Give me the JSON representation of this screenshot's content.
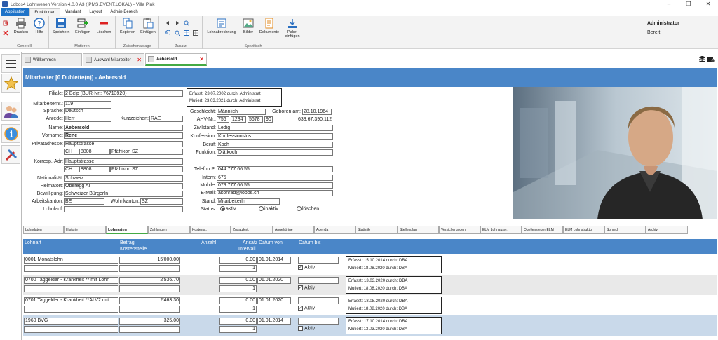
{
  "window": {
    "title": "Lobos4 Lohnwesen Version 4.0.0 A3 (IPMS.EVENT.LOKAL) - Villa Pink",
    "buttons": [
      "–",
      "❐",
      "✕"
    ]
  },
  "menu": {
    "tabs": [
      "Applikation",
      "Funktionen",
      "Mandant",
      "Layout",
      "Admin-Bereich"
    ]
  },
  "ribbon": {
    "groups": {
      "generell": "Generell",
      "mutieren": "Mutieren",
      "zwischenablage": "Zwischenablage",
      "zusatz": "Zusatz",
      "spezifisch": "Spezifisch"
    },
    "buttons": {
      "drucken": "Drucken",
      "hilfe": "Hilfe",
      "speichern": "Speichern",
      "einfuegen": "Einfügen",
      "loeschen": "Löschen",
      "kopieren": "Kopieren",
      "einfuegen2": "Einfügen",
      "lohnabrechnung": "Lohnabrechnung",
      "bilder": "Bilder",
      "dokumente": "Dokumente",
      "paket1": "Paket",
      "paket2": "einfügen"
    }
  },
  "user": {
    "name": "Administrator",
    "status": "Bereit"
  },
  "doc_tabs": {
    "willkommen": "Willkommen",
    "auswahl": "Auswahl Mitarbeiter",
    "aebersold": "Aebersold"
  },
  "header": {
    "title": "Mitarbeiter [0 Dublette(n)] - Aebersold"
  },
  "form": {
    "labels": {
      "filiale": "Filiale:",
      "mitarbeiternr": "Mitarbeiternr.:",
      "sprache": "Sprache:",
      "anrede": "Anrede:",
      "kurzzeichen": "Kurzzeichen:",
      "name": "Name:",
      "vorname": "Vorname:",
      "privatadresse": "Privatadresse:",
      "korresp": "Korresp.-Adr:",
      "nationalitaet": "Nationalität:",
      "heimatort": "Heimatort:",
      "bewilligung": "Bewilligung:",
      "arbeitskanton": "Arbeitskanton:",
      "wohnkanton": "Wohnkanton:",
      "lohnlauf": "Lohnlauf:",
      "geschlecht": "Geschlecht:",
      "geboren": "Geboren am:",
      "ahv": "AHV-Nr.:",
      "zivilstand": "Zivilstand:",
      "konfession": "Konfession:",
      "beruf": "Beruf:",
      "funktion": "Funktion:",
      "telefon": "Telefon P:",
      "intern": "Intern:",
      "mobile": "Mobile:",
      "email": "E-Mail:",
      "stand": "Stand:",
      "status": "Status:"
    },
    "values": {
      "filiale": "2 Belp (BUR-Nr.: 76713920)",
      "mitarbeiternr": "119",
      "sprache": "Deutsch",
      "anrede": "Herr",
      "kurzzeichen": "RAE",
      "name": "Aebersold",
      "vorname": "Rene",
      "priv_strasse": "Hauptstrasse",
      "priv_land": "CH",
      "priv_plz": "8808",
      "priv_ort": "Pfäffikon SZ",
      "kor_strasse": "Hauptstrasse",
      "kor_land": "CH",
      "kor_plz": "8808",
      "kor_ort": "Pfäffikon SZ",
      "nationalitaet": "Schweiz",
      "heimatort": "Oberegg AI",
      "bewilligung": "Schweizer BürgerIn",
      "arbeitskanton": "BE",
      "wohnkanton": "SZ",
      "lohnlauf": "",
      "geschlecht": "Männlich",
      "geboren": "28.10.1964",
      "ahv1": "756",
      "ahv2": "1234",
      "ahv3": "5678",
      "ahv4": "90",
      "ahv_alt": "633.67.390.112",
      "zivilstand": "Ledig",
      "konfession": "Konfessionslos",
      "beruf": "Koch",
      "funktion": "Diätkoch",
      "telefon": "044 777 66 55",
      "intern": "675",
      "mobile": "079 777 66 55",
      "email": "akonrad@lobos.ch",
      "stand": "MitarbeiterIn"
    },
    "status_options": {
      "aktiv": "aktiv",
      "inaktiv": "inaktiv",
      "loeschen": "löschen"
    },
    "audit": {
      "erfasst": "Erfasst: 23.07.2002 durch: Administrat",
      "mutiert": "Mutiert: 23.03.2021 durch: Administrat"
    }
  },
  "subtabs": [
    "Lohndaten",
    "Historie",
    "Lohnarten",
    "Zahlungen",
    "Kostenst.",
    "Zusatzknt.",
    "Angehörige",
    "Agenda",
    "Statistik",
    "Stellenplan",
    "Versicherungen",
    "ELM Lohnausw.",
    "Quellensteuer ELM",
    "ELM Lohnstruktur",
    "Somed",
    "Archiv"
  ],
  "grid": {
    "headers": {
      "lohnart": "Lohnart",
      "betrag": "Betrag",
      "kostenstelle": "Kostenstelle",
      "anzahl": "Anzahl",
      "ansatz": "Ansatz",
      "intervall": "Intervall",
      "datum_von": "Datum von",
      "datum_bis": "Datum bis"
    },
    "aktiv_label": "Aktiv",
    "rows": [
      {
        "lohnart": "0001 Monatslohn",
        "betrag": "15'000.00",
        "ansatz": "0.00",
        "datum_von": "01.01.2014",
        "intervall": "1",
        "aktiv": true,
        "erfasst": "Erfasst: 15.10.2014  durch: DBA",
        "mutiert": "Mutiert: 18.08.2020  durch: DBA"
      },
      {
        "lohnart": "0700 Taggelder - Krankheit ** mit Lohn",
        "betrag": "2'536.70",
        "ansatz": "0.00",
        "datum_von": "01.01.2020",
        "intervall": "1",
        "aktiv": true,
        "erfasst": "Erfasst: 13.03.2020  durch: DBA",
        "mutiert": "Mutiert: 18.08.2020  durch: DBA"
      },
      {
        "lohnart": "0701 Taggelder - Krankheit **ALV2 mit",
        "betrag": "2'463.30",
        "ansatz": "0.00",
        "datum_von": "01.01.2020",
        "intervall": "1",
        "aktiv": true,
        "erfasst": "Erfasst: 18.08.2020  durch: DBA",
        "mutiert": "Mutiert: 18.08.2020  durch: DBA"
      },
      {
        "lohnart": "1960 BVG",
        "betrag": "325.00",
        "ansatz": "0.00",
        "datum_von": "01.01.2014",
        "intervall": "1",
        "aktiv": false,
        "erfasst": "Erfasst: 17.10.2014  durch: DBA",
        "mutiert": "Mutiert: 13.03.2020  durch: DBA"
      }
    ]
  }
}
